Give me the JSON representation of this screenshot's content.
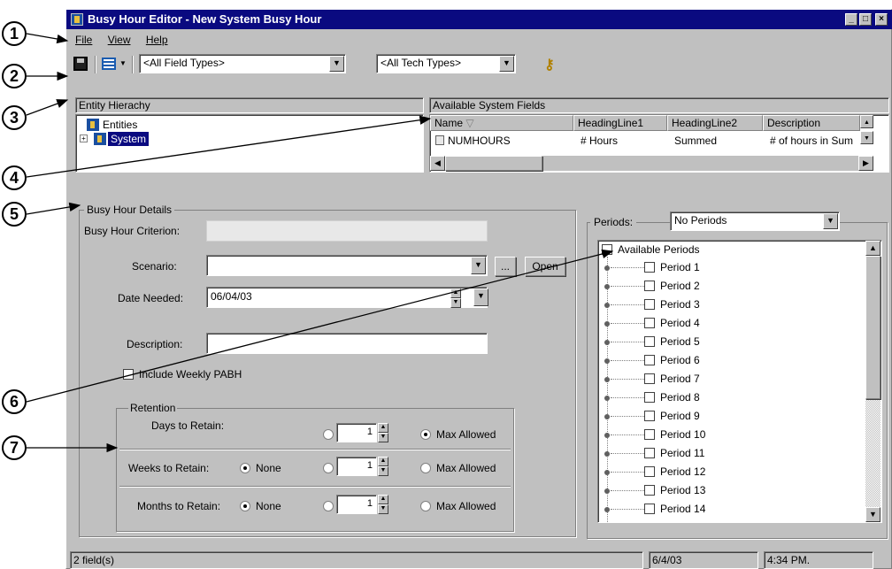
{
  "window": {
    "title": "Busy Hour Editor - New System Busy Hour",
    "controls": [
      "_",
      "□",
      "×"
    ]
  },
  "menu": {
    "items": [
      "File",
      "View",
      "Help"
    ]
  },
  "toolbar": {
    "field_types": "<All Field Types>",
    "tech_types": "<All Tech Types>"
  },
  "entity_hierarchy": {
    "header": "Entity Hierachy",
    "root": "Entities",
    "child": "System"
  },
  "system_fields": {
    "header": "Available System Fields",
    "columns": [
      "Name",
      "HeadingLine1",
      "HeadingLine2",
      "Description"
    ],
    "row": [
      "NUMHOURS",
      "# Hours",
      "Summed",
      "# of hours in Sum"
    ]
  },
  "details": {
    "group_label": "Busy Hour Details",
    "criterion_label": "Busy Hour Criterion:",
    "scenario_label": "Scenario:",
    "browse_label": "...",
    "open_label": "Open",
    "date_label": "Date Needed:",
    "date_value": "06/04/03",
    "description_label": "Description:",
    "weekly_label": "Include Weekly PABH"
  },
  "retention": {
    "label": "Retention",
    "rows": [
      {
        "label": "Days to Retain:",
        "value": "1",
        "none_label": "",
        "max_label": "Max Allowed",
        "max_selected": true
      },
      {
        "label": "Weeks to Retain:",
        "value": "1",
        "none_label": "None",
        "max_label": "Max Allowed",
        "max_selected": false
      },
      {
        "label": "Months to Retain:",
        "value": "1",
        "none_label": "None",
        "max_label": "Max Allowed",
        "max_selected": false
      }
    ]
  },
  "periods": {
    "label": "Periods:",
    "selected": "No Periods",
    "root": "Available Periods",
    "items": [
      "Period 1",
      "Period 2",
      "Period 3",
      "Period 4",
      "Period 5",
      "Period 6",
      "Period 7",
      "Period 8",
      "Period 9",
      "Period 10",
      "Period 11",
      "Period 12",
      "Period 13",
      "Period 14"
    ]
  },
  "status": {
    "fields": "2 field(s)",
    "date": "6/4/03",
    "time": "4:34 PM."
  },
  "callouts": [
    "1",
    "2",
    "3",
    "4",
    "5",
    "6",
    "7"
  ]
}
